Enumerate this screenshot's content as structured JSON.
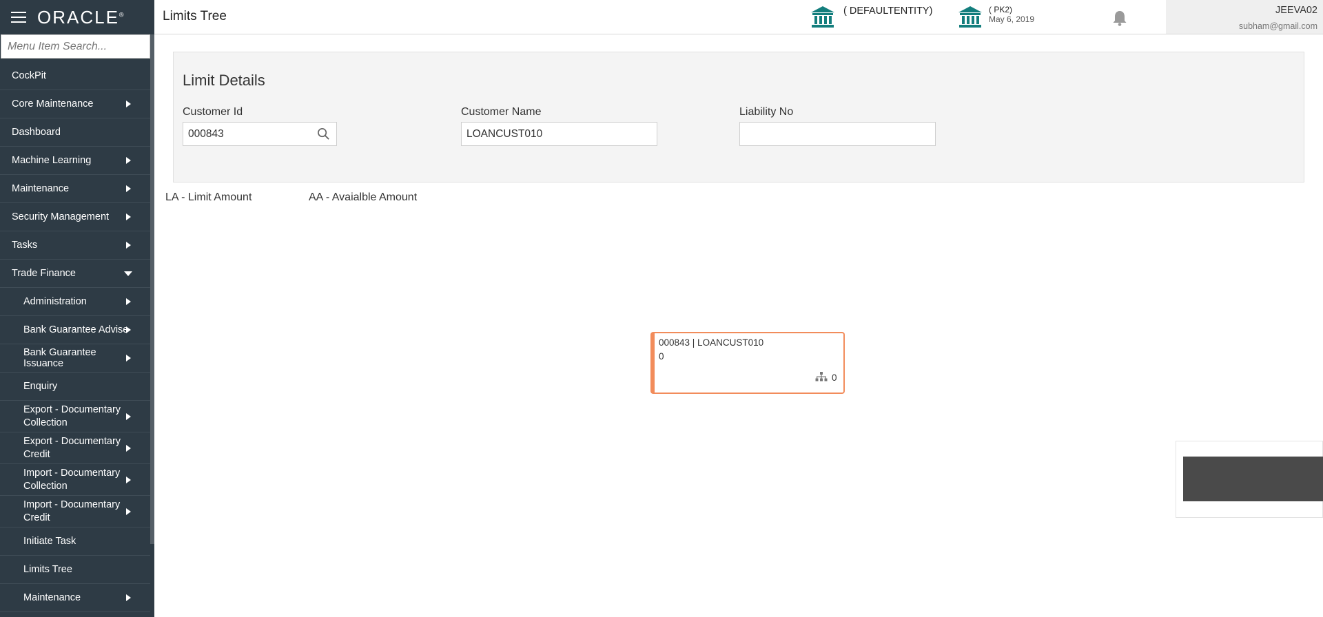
{
  "app": {
    "logo_text": "ORACLE",
    "page_title": "Limits Tree"
  },
  "header": {
    "entity": "( DEFAULTENTITY)",
    "branch": "( PK2)",
    "branch_date": "May 6, 2019",
    "user_name": "JEEVA02",
    "user_email": "subham@gmail.com",
    "accent_color": "#137e7d"
  },
  "sidebar": {
    "search_placeholder": "Menu Item Search...",
    "items": [
      {
        "label": "CockPit",
        "arrow": false,
        "level": 0
      },
      {
        "label": "Core Maintenance",
        "arrow": true,
        "level": 0
      },
      {
        "label": "Dashboard",
        "arrow": false,
        "level": 0
      },
      {
        "label": "Machine Learning",
        "arrow": true,
        "level": 0
      },
      {
        "label": "Maintenance",
        "arrow": true,
        "level": 0
      },
      {
        "label": "Security Management",
        "arrow": true,
        "level": 0
      },
      {
        "label": "Tasks",
        "arrow": true,
        "level": 0
      },
      {
        "label": "Trade Finance",
        "arrow": "down",
        "level": 0
      },
      {
        "label": "Administration",
        "arrow": true,
        "level": 1
      },
      {
        "label": "Bank Guarantee Advise",
        "arrow": true,
        "level": 1
      },
      {
        "label": "Bank Guarantee Issuance",
        "arrow": true,
        "level": 1
      },
      {
        "label": "Enquiry",
        "arrow": false,
        "level": 1
      },
      {
        "label": "Export - Documentary Collection",
        "arrow": true,
        "level": 1
      },
      {
        "label": "Export - Documentary Credit",
        "arrow": true,
        "level": 1
      },
      {
        "label": "Import - Documentary Collection",
        "arrow": true,
        "level": 1
      },
      {
        "label": "Import - Documentary Credit",
        "arrow": true,
        "level": 1
      },
      {
        "label": "Initiate Task",
        "arrow": false,
        "level": 1
      },
      {
        "label": "Limits Tree",
        "arrow": false,
        "level": 1
      },
      {
        "label": "Maintenance",
        "arrow": true,
        "level": 1
      }
    ]
  },
  "limit_details": {
    "title": "Limit Details",
    "customer_id_label": "Customer Id",
    "customer_id_value": "000843",
    "customer_name_label": "Customer Name",
    "customer_name_value": "LOANCUST010",
    "liability_no_label": "Liability No",
    "liability_no_value": ""
  },
  "legend": {
    "la": "LA - Limit Amount",
    "aa": "AA - Avaialble Amount"
  },
  "tree_node": {
    "title": "000843 | LOANCUST010",
    "amount": "0",
    "children_count": "0",
    "border_color": "#f28c5b"
  }
}
